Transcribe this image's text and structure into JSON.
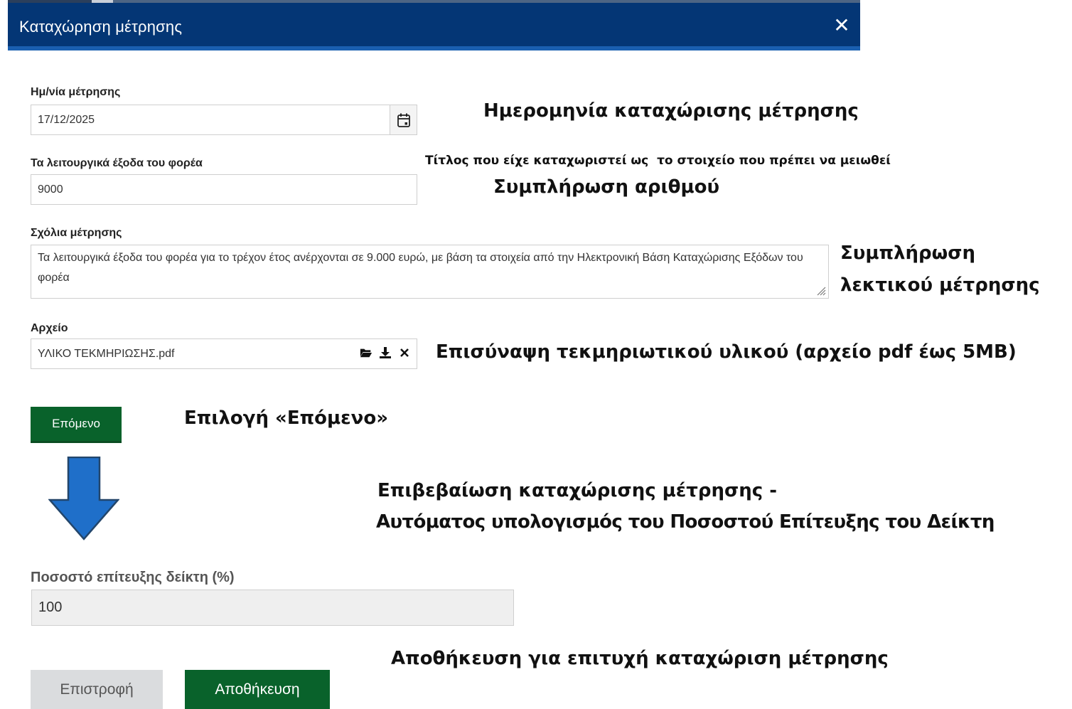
{
  "dialog": {
    "title": "Καταχώρηση μέτρησης",
    "close_icon": "close-icon"
  },
  "form": {
    "date_label": "Ημ/νία μέτρησης",
    "date_value": "17/12/2025",
    "calendar_icon": "calendar-icon",
    "expenses_label": "Τα λειτουργικά έξοδα του φορέα",
    "expenses_value": "9000",
    "comments_label": "Σχόλια μέτρησης",
    "comments_value": "Τα λειτουργικά έξοδα του φορέα για το τρέχον έτος ανέρχονται σε 9.000 ευρώ, με βάση τα στοιχεία από την Ηλεκτρονική Βάση Καταχώρισης Εξόδων του φορέα",
    "file_label": "Αρχείο",
    "file_value": "ΥΛΙΚΟ ΤΕΚΜΗΡΙΩΣΗΣ.pdf",
    "file_icons": [
      "folder-open-icon",
      "download-icon",
      "close-icon"
    ],
    "next_button": "Επόμενο"
  },
  "result": {
    "percentage_label": "Ποσοστό επίτευξης δείκτη (%)",
    "percentage_value": "100",
    "back_button": "Επιστροφή",
    "save_button": "Αποθήκευση"
  },
  "annotations": {
    "date_note": "Ημερομηνία καταχώρισης μέτρησης",
    "title_note": "Τίτλος που είχε καταχωριστεί ως  το στοιχείο που πρέπει να μειωθεί",
    "number_note": "Συμπλήρωση αριθμού",
    "comment_note_line1": "Συμπλήρωση",
    "comment_note_line2": "λεκτικού μέτρησης",
    "file_note": "Επισύναψη τεκμηριωτικού υλικού (αρχείο pdf έως 5MB)",
    "next_note": "Επιλογή «Επόμενο»",
    "confirm_note_line1": "Επιβεβαίωση καταχώρισης μέτρησης -",
    "confirm_note_line2": "Αυτόματος υπολογισμός του Ποσοστού Επίτευξης του Δείκτη",
    "save_note": "Αποθήκευση για επιτυχή καταχώριση μέτρησης"
  },
  "colors": {
    "header_bg": "#043675",
    "header_accent": "#1a5fb0",
    "primary_button": "#09622b",
    "secondary_button": "#dadcde",
    "arrow_fill": "#1f6fc9",
    "arrow_stroke": "#23466b"
  }
}
